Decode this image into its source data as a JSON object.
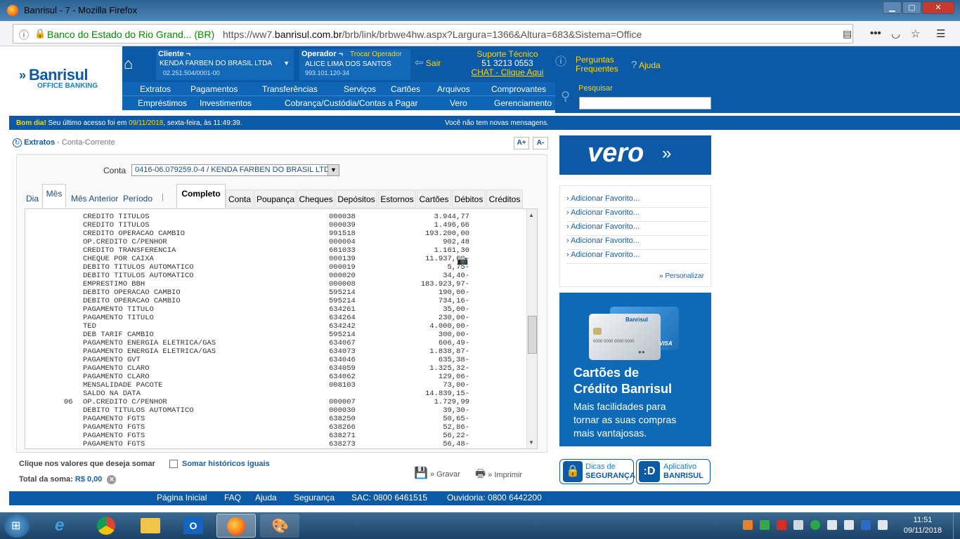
{
  "window": {
    "title": "Banrisul - 7 - Mozilla Firefox"
  },
  "browser": {
    "site_identity": "Banco do Estado do Rio Grand... (BR)",
    "url_prefix": "https://ww7.",
    "url_domain": "banrisul.com.br",
    "url_rest": "/brb/link/brbwe4hw.aspx?Largura=1366&Altura=683&Sistema=Office"
  },
  "brand": {
    "name": "Banrisul",
    "tagline": "OFFICE BANKING"
  },
  "cliente": {
    "label": "Cliente ¬",
    "name": "KENDA FARBEN DO BRASIL LTDA",
    "cnpj": "02.251.504/0001-00"
  },
  "operador": {
    "label": "Operador ¬",
    "change": "Trocar Operador",
    "name": "ALICE LIMA DOS SANTOS",
    "id": "993.101.120-34"
  },
  "sair": "Sair",
  "suporte": {
    "title": "Suporte Técnico",
    "phone": "51 3213 0553",
    "chat": "CHAT - Clique Aqui"
  },
  "perguntas": [
    "Perguntas",
    "Frequentes"
  ],
  "ajuda": "Ajuda",
  "nav_row1": [
    "Extratos",
    "Pagamentos",
    "Transferências",
    "Serviços",
    "Cartões",
    "Arquivos",
    "Comprovantes"
  ],
  "nav_row2": [
    "Empréstimos",
    "Investimentos",
    "Cobrança/Custódia/Contas a Pagar",
    "Vero",
    "Gerenciamento"
  ],
  "search": {
    "label": "Pesquisar",
    "value": ""
  },
  "greeting": {
    "bom_dia": "Bom dia!",
    "text": " Seu último acesso foi em ",
    "date": "09/11/2018",
    ",": ", sexta-feira, às 11:49:39.",
    "messages": "Você não tem novas mensagens."
  },
  "breadcrumb": {
    "section": "Extratos",
    "sub": "- Conta-Corrente"
  },
  "font_buttons": [
    "A+",
    "A-"
  ],
  "conta": {
    "label": "Conta",
    "value": "0416-06.079259.0-4 / KENDA FARBEN DO BRASIL LTDA"
  },
  "period_tabs": [
    "Dia",
    "Mês",
    "Mês Anterior",
    "Período"
  ],
  "type_tabs": [
    "Completo",
    "Conta",
    "Poupança",
    "Cheques",
    "Depósitos",
    "Estornos",
    "Cartões",
    "Débitos",
    "Créditos"
  ],
  "statement_rows": [
    {
      "day": "",
      "hist": "CREDITO TITULOS",
      "doc": "000038",
      "val": "3.944,77"
    },
    {
      "day": "",
      "hist": "CREDITO TITULOS",
      "doc": "000039",
      "val": "1.496,66"
    },
    {
      "day": "",
      "hist": "CREDITO OPERACAO CAMBIO",
      "doc": "991518",
      "val": "193.200,00"
    },
    {
      "day": "",
      "hist": "OP.CREDITO C/PENHOR",
      "doc": "000004",
      "val": "902,48"
    },
    {
      "day": "",
      "hist": "CREDITO TRANSFERENCIA",
      "doc": "681033",
      "val": "1.161,30"
    },
    {
      "day": "",
      "hist": "CHEQUE POR CAIXA",
      "doc": "000139",
      "val": "11.937,68-"
    },
    {
      "day": "",
      "hist": "DEBITO TITULOS AUTOMATICO",
      "doc": "000019",
      "val": "5,75-"
    },
    {
      "day": "",
      "hist": "DEBITO TITULOS AUTOMATICO",
      "doc": "000020",
      "val": "34,40-"
    },
    {
      "day": "",
      "hist": "EMPRESTIMO BBH",
      "doc": "000008",
      "val": "183.923,97-"
    },
    {
      "day": "",
      "hist": "DEBITO OPERACAO CAMBIO",
      "doc": "595214",
      "val": "190,00-"
    },
    {
      "day": "",
      "hist": "DEBITO OPERACAO CAMBIO",
      "doc": "595214",
      "val": "734,16-"
    },
    {
      "day": "",
      "hist": "PAGAMENTO TITULO",
      "doc": "634261",
      "val": "35,00-"
    },
    {
      "day": "",
      "hist": "PAGAMENTO TITULO",
      "doc": "634264",
      "val": "230,00-"
    },
    {
      "day": "",
      "hist": "TED",
      "doc": "634242",
      "val": "4.000,00-"
    },
    {
      "day": "",
      "hist": "DEB TARIF CAMBIO",
      "doc": "595214",
      "val": "300,00-"
    },
    {
      "day": "",
      "hist": "PAGAMENTO ENERGIA ELETRICA/GAS",
      "doc": "634067",
      "val": "606,49-"
    },
    {
      "day": "",
      "hist": "PAGAMENTO ENERGIA ELETRICA/GAS",
      "doc": "634073",
      "val": "1.838,87-"
    },
    {
      "day": "",
      "hist": "PAGAMENTO GVT",
      "doc": "634046",
      "val": "635,38-"
    },
    {
      "day": "",
      "hist": "PAGAMENTO CLARO",
      "doc": "634059",
      "val": "1.325,32-"
    },
    {
      "day": "",
      "hist": "PAGAMENTO CLARO",
      "doc": "634062",
      "val": "129,06-"
    },
    {
      "day": "",
      "hist": "MENSALIDADE PACOTE",
      "doc": "008103",
      "val": "73,00-"
    },
    {
      "day": "",
      "hist": "SALDO NA DATA",
      "doc": "",
      "val": "14.839,15-"
    },
    {
      "day": "06",
      "hist": "OP.CREDITO C/PENHOR",
      "doc": "000007",
      "val": "1.729,99"
    },
    {
      "day": "",
      "hist": "DEBITO TITULOS AUTOMATICO",
      "doc": "000030",
      "val": "39,30-"
    },
    {
      "day": "",
      "hist": "PAGAMENTO FGTS",
      "doc": "638250",
      "val": "50,65-"
    },
    {
      "day": "",
      "hist": "PAGAMENTO FGTS",
      "doc": "638266",
      "val": "52,86-"
    },
    {
      "day": "",
      "hist": "PAGAMENTO FGTS",
      "doc": "638271",
      "val": "56,22-"
    },
    {
      "day": "",
      "hist": "PAGAMENTO FGTS",
      "doc": "638273",
      "val": "56,48-"
    }
  ],
  "sum": {
    "hint": "Clique nos valores que deseja somar",
    "checkbox_label": "Somar históricos iguais",
    "total_label": "Total da soma:",
    "total_value": "R$ 0,00"
  },
  "actions": {
    "gravar": "» Gravar",
    "imprimir": "» Imprimir"
  },
  "vero_logo": "vero",
  "favorites": [
    "Adicionar Favorito...",
    "Adicionar Favorito...",
    "Adicionar Favorito...",
    "Adicionar Favorito...",
    "Adicionar Favorito..."
  ],
  "personalizar": "» Personalizar",
  "card_ad": {
    "title1": "Cartões de",
    "title2": "Crédito Banrisul",
    "line1": "Mais facilidades para",
    "line2": "tornar as suas compras",
    "line3": "mais vantajosas.",
    "card_brand": "Banrisul",
    "card_number": "0000 0000 0000 0000",
    "card_visa": "VISA"
  },
  "dicas": [
    "Dicas de",
    "SEGURANÇA"
  ],
  "app": [
    "Aplicativo",
    "BANRISUL"
  ],
  "footer": [
    "Página Inicial",
    "FAQ",
    "Ajuda",
    "Segurança",
    "SAC: 0800 6461515",
    "Ouvidoria: 0800 6442200"
  ],
  "clock": {
    "time": "11:51",
    "date": "09/11/2018"
  },
  "colors": {
    "brand_blue": "#0c5aa6",
    "accent_yellow": "#ffd700",
    "card_blue": "#0e6ab7"
  }
}
